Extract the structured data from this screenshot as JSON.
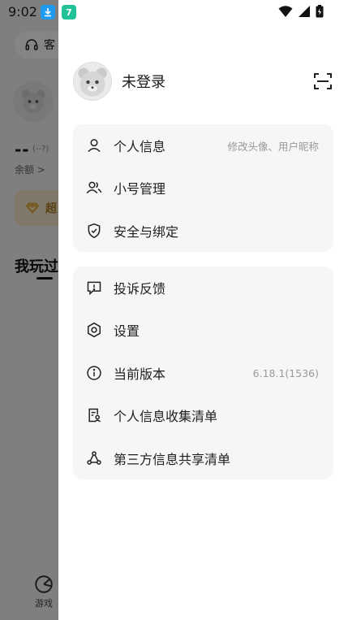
{
  "status_bar": {
    "time": "9:02",
    "badge_b_text": "7"
  },
  "background": {
    "service_label": "客",
    "dashes": "--",
    "dashes_note": "(--?)",
    "balance_label": "余额 >",
    "vip_label": "超",
    "played_title": "我玩过",
    "nav_games": "游戏"
  },
  "drawer": {
    "profile_name": "未登录",
    "section1": [
      {
        "label": "个人信息",
        "value": "修改头像、用户昵称",
        "icon": "user-icon"
      },
      {
        "label": "小号管理",
        "value": "",
        "icon": "users-icon"
      },
      {
        "label": "安全与绑定",
        "value": "",
        "icon": "shield-check-icon"
      }
    ],
    "section2": [
      {
        "label": "投诉反馈",
        "value": "",
        "icon": "feedback-icon"
      },
      {
        "label": "设置",
        "value": "",
        "icon": "gear-icon"
      },
      {
        "label": "当前版本",
        "value": "6.18.1(1536)",
        "icon": "info-icon"
      },
      {
        "label": "个人信息收集清单",
        "value": "",
        "icon": "document-user-icon"
      },
      {
        "label": "第三方信息共享清单",
        "value": "",
        "icon": "share-icon"
      }
    ]
  },
  "colors": {
    "dim_overlay": "#7a7a7a",
    "card_bg": "#f6f6f6",
    "download_badge": "#1e9bf0",
    "app_badge": "#22c39b",
    "vip_bg": "#f6e8c9"
  }
}
